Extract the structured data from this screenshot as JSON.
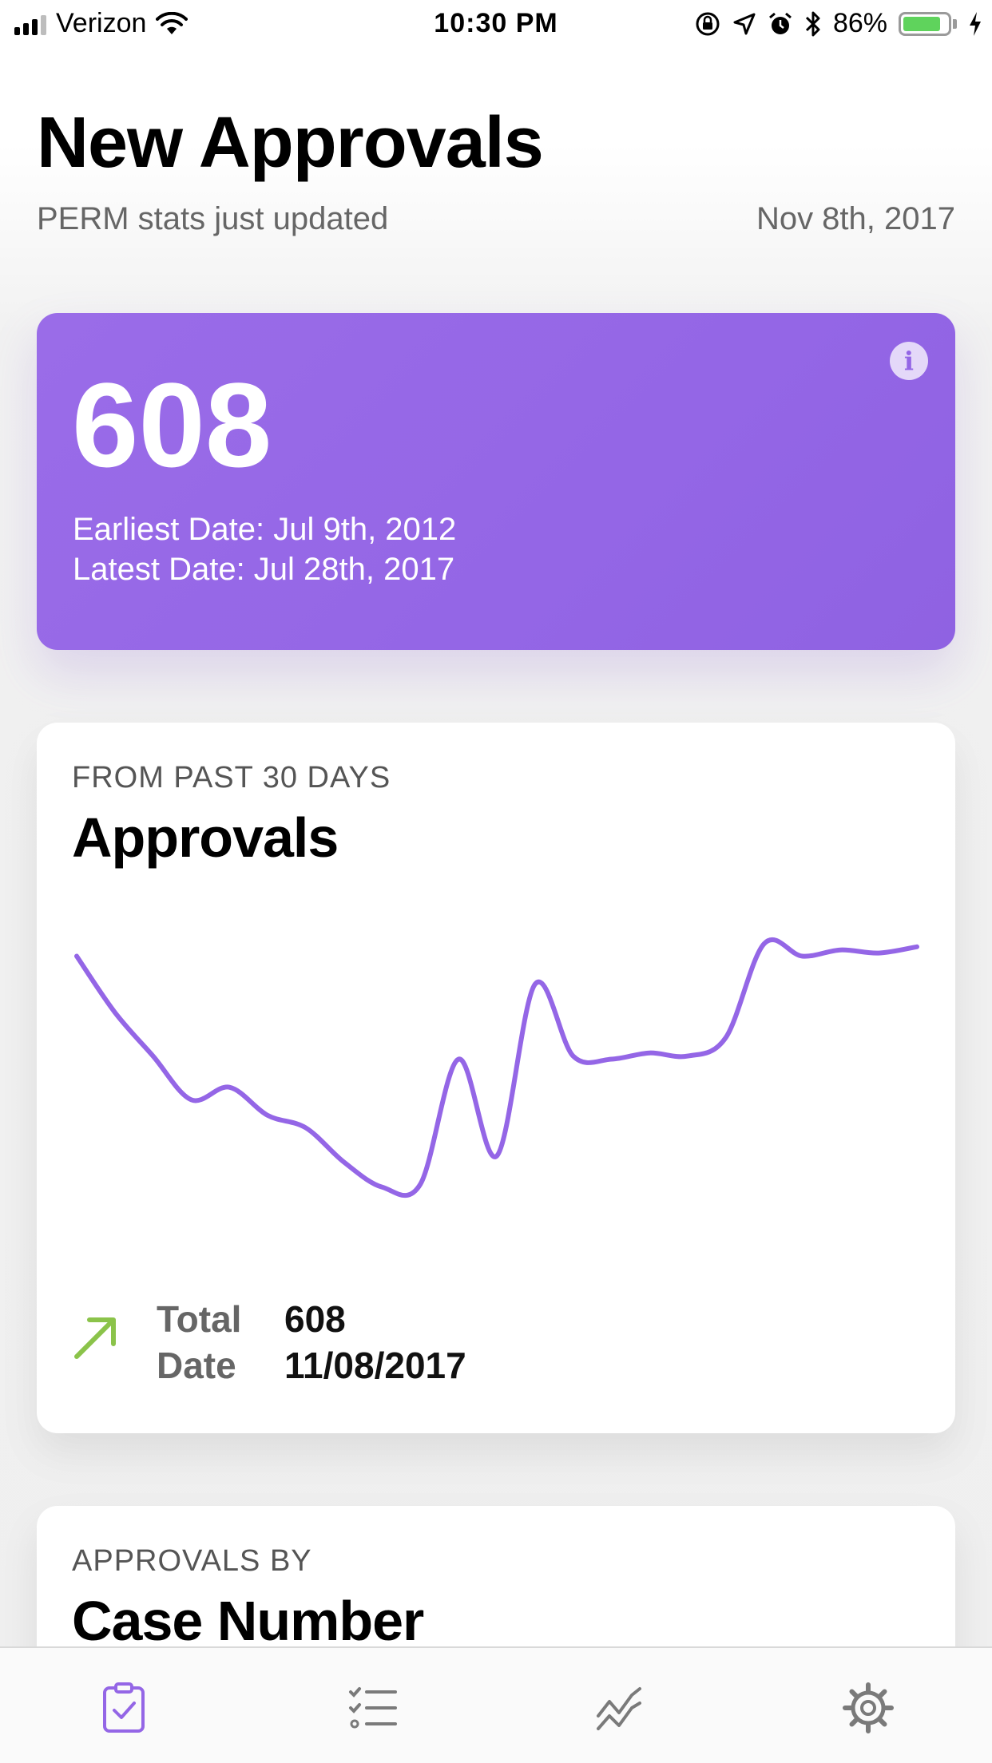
{
  "status_bar": {
    "carrier": "Verizon",
    "time": "10:30 PM",
    "battery_percent": "86%",
    "battery_level": 0.86
  },
  "header": {
    "title": "New Approvals",
    "subtitle": "PERM stats just updated",
    "date": "Nov 8th, 2017"
  },
  "summary_card": {
    "count": "608",
    "earliest": "Earliest Date: Jul 9th, 2012",
    "latest": "Latest Date: Jul 28th, 2017",
    "color": "#9466e6"
  },
  "approvals_card": {
    "eyebrow": "FROM PAST 30 DAYS",
    "title": "Approvals",
    "total_label": "Total",
    "total_value": "608",
    "date_label": "Date",
    "date_value": "11/08/2017"
  },
  "case_card": {
    "eyebrow": "APPROVALS BY",
    "title": "Case Number"
  },
  "chart_data": {
    "type": "line",
    "x": [
      1,
      2,
      3,
      4,
      5,
      6,
      7,
      8,
      9,
      10,
      11,
      12,
      13,
      14,
      15,
      16,
      17,
      18,
      19,
      20,
      21,
      22,
      23
    ],
    "series": [
      {
        "values": [
          94,
          76,
          62,
          48,
          52,
          43,
          39,
          28,
          20,
          21,
          61,
          30,
          85,
          62,
          61,
          63,
          62,
          68,
          98,
          94,
          96,
          95,
          97
        ]
      }
    ],
    "ylim": [
      0,
      110
    ],
    "grid": false,
    "line_color": "#9466e6"
  },
  "tab_bar": {
    "items": [
      {
        "icon": "clipboard-check-icon",
        "active": true
      },
      {
        "icon": "checklist-icon",
        "active": false
      },
      {
        "icon": "trend-chart-icon",
        "active": false
      },
      {
        "icon": "gear-icon",
        "active": false
      }
    ],
    "active_color": "#9466e6",
    "inactive_color": "#7a7a7a"
  }
}
